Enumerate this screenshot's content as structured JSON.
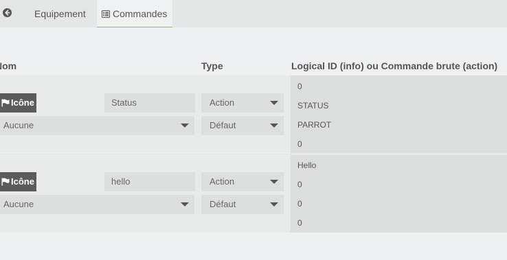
{
  "tabs": {
    "back_icon": "arrow-circle-left-icon",
    "equipement_label": "Equipement",
    "commandes_label": "Commandes",
    "commandes_icon": "list-alt-icon",
    "active_underline_color": "#94ca02"
  },
  "table": {
    "headers": {
      "nom": "Nom",
      "type": "Type",
      "logical": "Logical ID (info) ou Commande brute (action)"
    },
    "rows": [
      {
        "icon_button_label": "Icône",
        "icon_button_icon": "flag-icon",
        "name_value": "Status",
        "type_value": "Action",
        "subtype_value": "Défaut",
        "group_value": "Aucune",
        "logical_lines": [
          "0",
          "STATUS",
          "PARROT",
          "0"
        ]
      },
      {
        "icon_button_label": "Icône",
        "icon_button_icon": "flag-icon",
        "name_value": "hello",
        "type_value": "Action",
        "subtype_value": "Défaut",
        "group_value": "Aucune",
        "logical_lines": [
          "Hello",
          "0",
          "0",
          "0"
        ]
      }
    ]
  }
}
